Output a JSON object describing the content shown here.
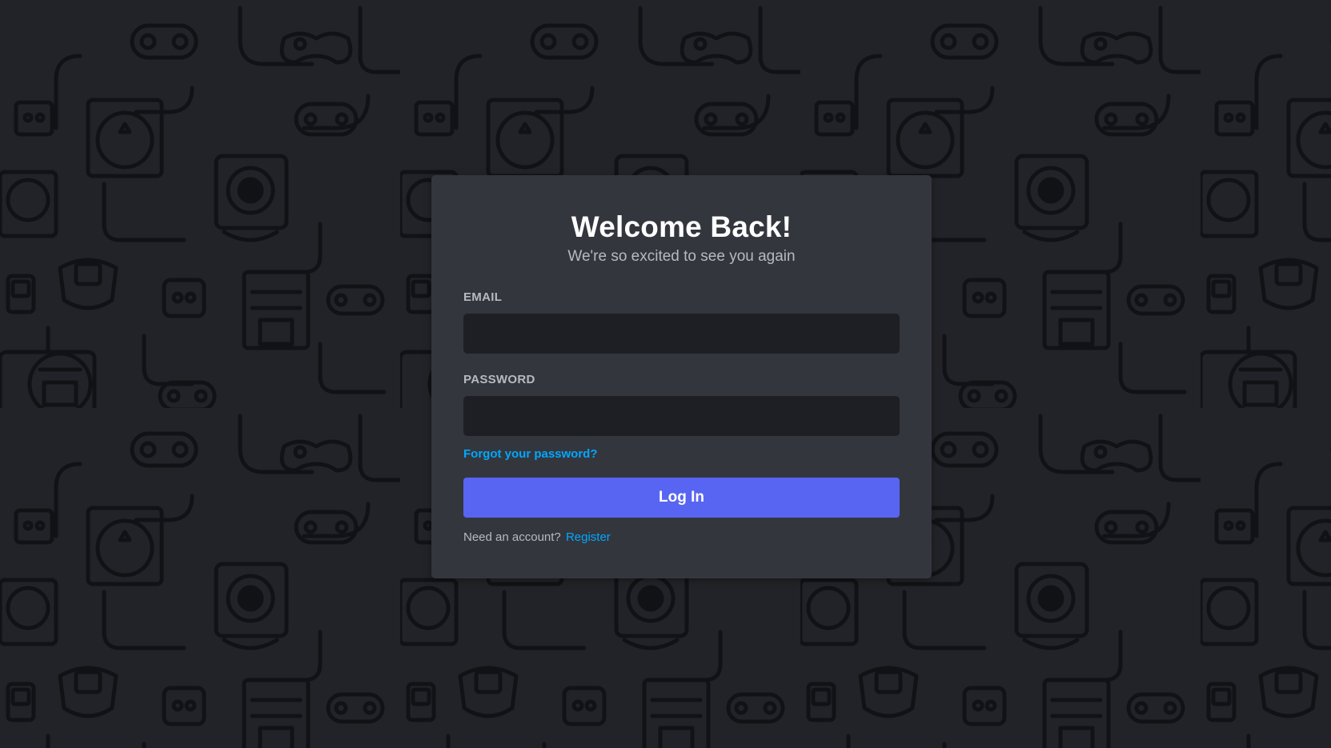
{
  "login": {
    "title": "Welcome Back!",
    "subtitle": "We're so excited to see you again",
    "email_label": "EMAIL",
    "email_value": "",
    "password_label": "PASSWORD",
    "password_value": "",
    "forgot_link": "Forgot your password?",
    "submit_label": "Log In",
    "register_prompt": "Need an account?",
    "register_link": "Register"
  },
  "colors": {
    "background": "#222328",
    "card": "#34363e",
    "input": "#1e1f24",
    "primary_button": "#5865f2",
    "link": "#00a8fc",
    "muted_text": "#b5bac1",
    "pattern_stroke": "#111216"
  },
  "background_icons": [
    "gamepad-icon",
    "console-icon",
    "discord-logo-icon",
    "handheld-icon",
    "cartridge-icon"
  ]
}
